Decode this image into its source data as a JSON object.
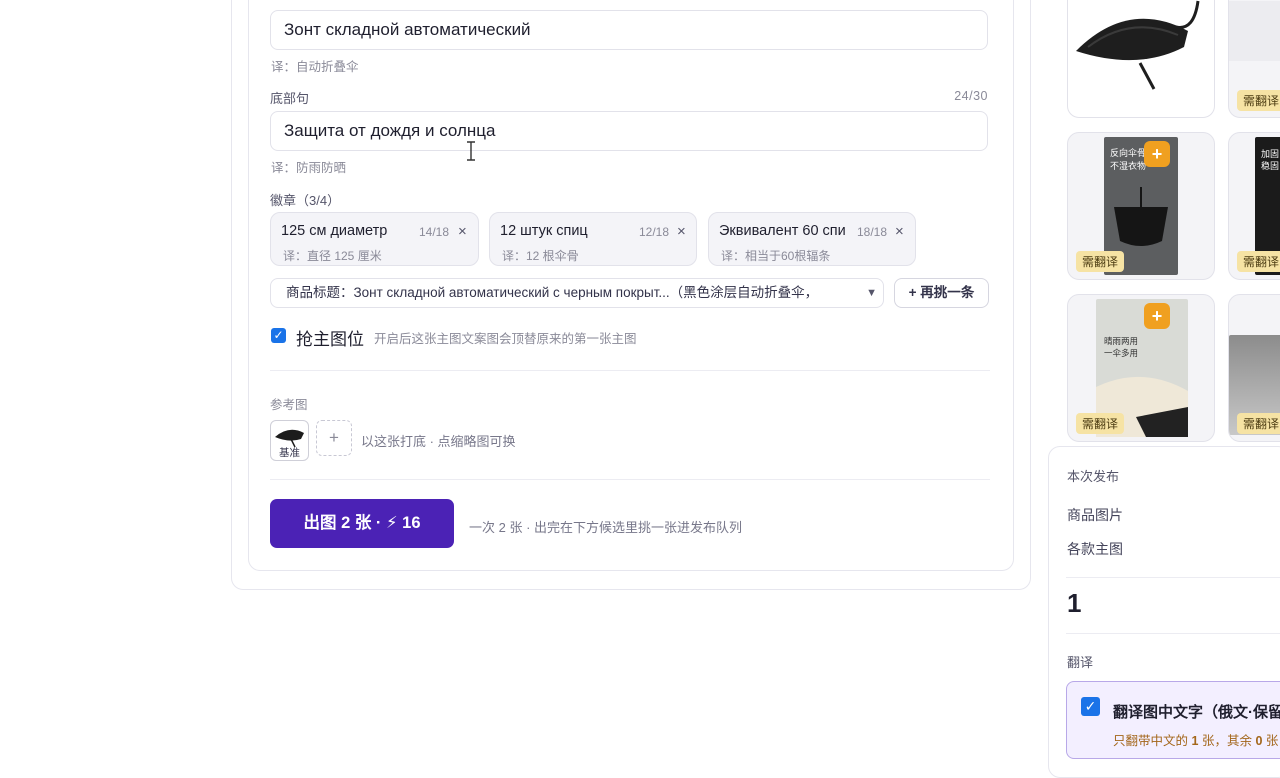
{
  "form": {
    "title_input": "Зонт складной автоматический",
    "title_translation": "译：自动折叠伞",
    "subtitle_label": "底部句",
    "subtitle_counter": "24/30",
    "subtitle_input": "Защита от дождя и солнца",
    "subtitle_translation": "译：防雨防晒",
    "badges_label": "徽章（3/4）",
    "badges": [
      {
        "text": "125 см диаметр",
        "count": "14/18",
        "translation": "译：直径 125 厘米"
      },
      {
        "text": "12 штук спиц",
        "count": "12/18",
        "translation": "译：12 根伞骨"
      },
      {
        "text": "Эквивалент 60 спи",
        "count": "18/18",
        "translation": "译：相当于60根辐条"
      }
    ],
    "close_glyph": "×",
    "product_title_select": "商品标题：Зонт складной автоматический с черным покрыт...（黑色涂层自动折叠伞，",
    "pick_another_button": "+ 再挑一条",
    "main_image_checkbox_label": "抢主图位",
    "main_image_checkbox_hint": "开启后这张主图文案图会顶替原来的第一张主图",
    "main_image_checked": true,
    "reference_label": "参考图",
    "reference_thumb_caption": "基准",
    "reference_hint": "以这张打底 · 点缩略图可换",
    "generate_button": "出图 2 张 · ⚡ 16",
    "generate_hint": "一次 2 张 · 出完在下方候选里挑一张进发布队列"
  },
  "gallery": {
    "tag_label": "需翻译",
    "plus_glyph": "+",
    "posters": [
      {
        "line1": "反向伞骨",
        "line2": "不湿衣物"
      },
      {
        "line1": "加固",
        "line2": "稳固"
      },
      {
        "line1": "晴雨两用",
        "line2": "一伞多用"
      }
    ]
  },
  "publish_panel": {
    "title": "本次发布",
    "item_product_images": "商品图片",
    "item_main_images": "各款主图",
    "count": "1",
    "translate_label": "翻译",
    "translate_option": "翻译图中文字（俄文·保留",
    "translate_checked": true,
    "translate_note_prefix": "只翻带中文的",
    "translate_note_count": "1",
    "translate_note_mid": "张，其余",
    "translate_note_rest": "0",
    "translate_note_suffix": "张"
  },
  "colors": {
    "primary_button": "#4b22b5",
    "checkbox_blue": "#1a73e8",
    "tag_yellow": "#f6e3a4",
    "plus_orange": "#f0a020"
  },
  "icons": [
    "text-cursor-icon",
    "close-icon",
    "chevron-down-icon",
    "checkbox-icon",
    "plus-icon",
    "bolt-icon",
    "umbrella-image"
  ]
}
